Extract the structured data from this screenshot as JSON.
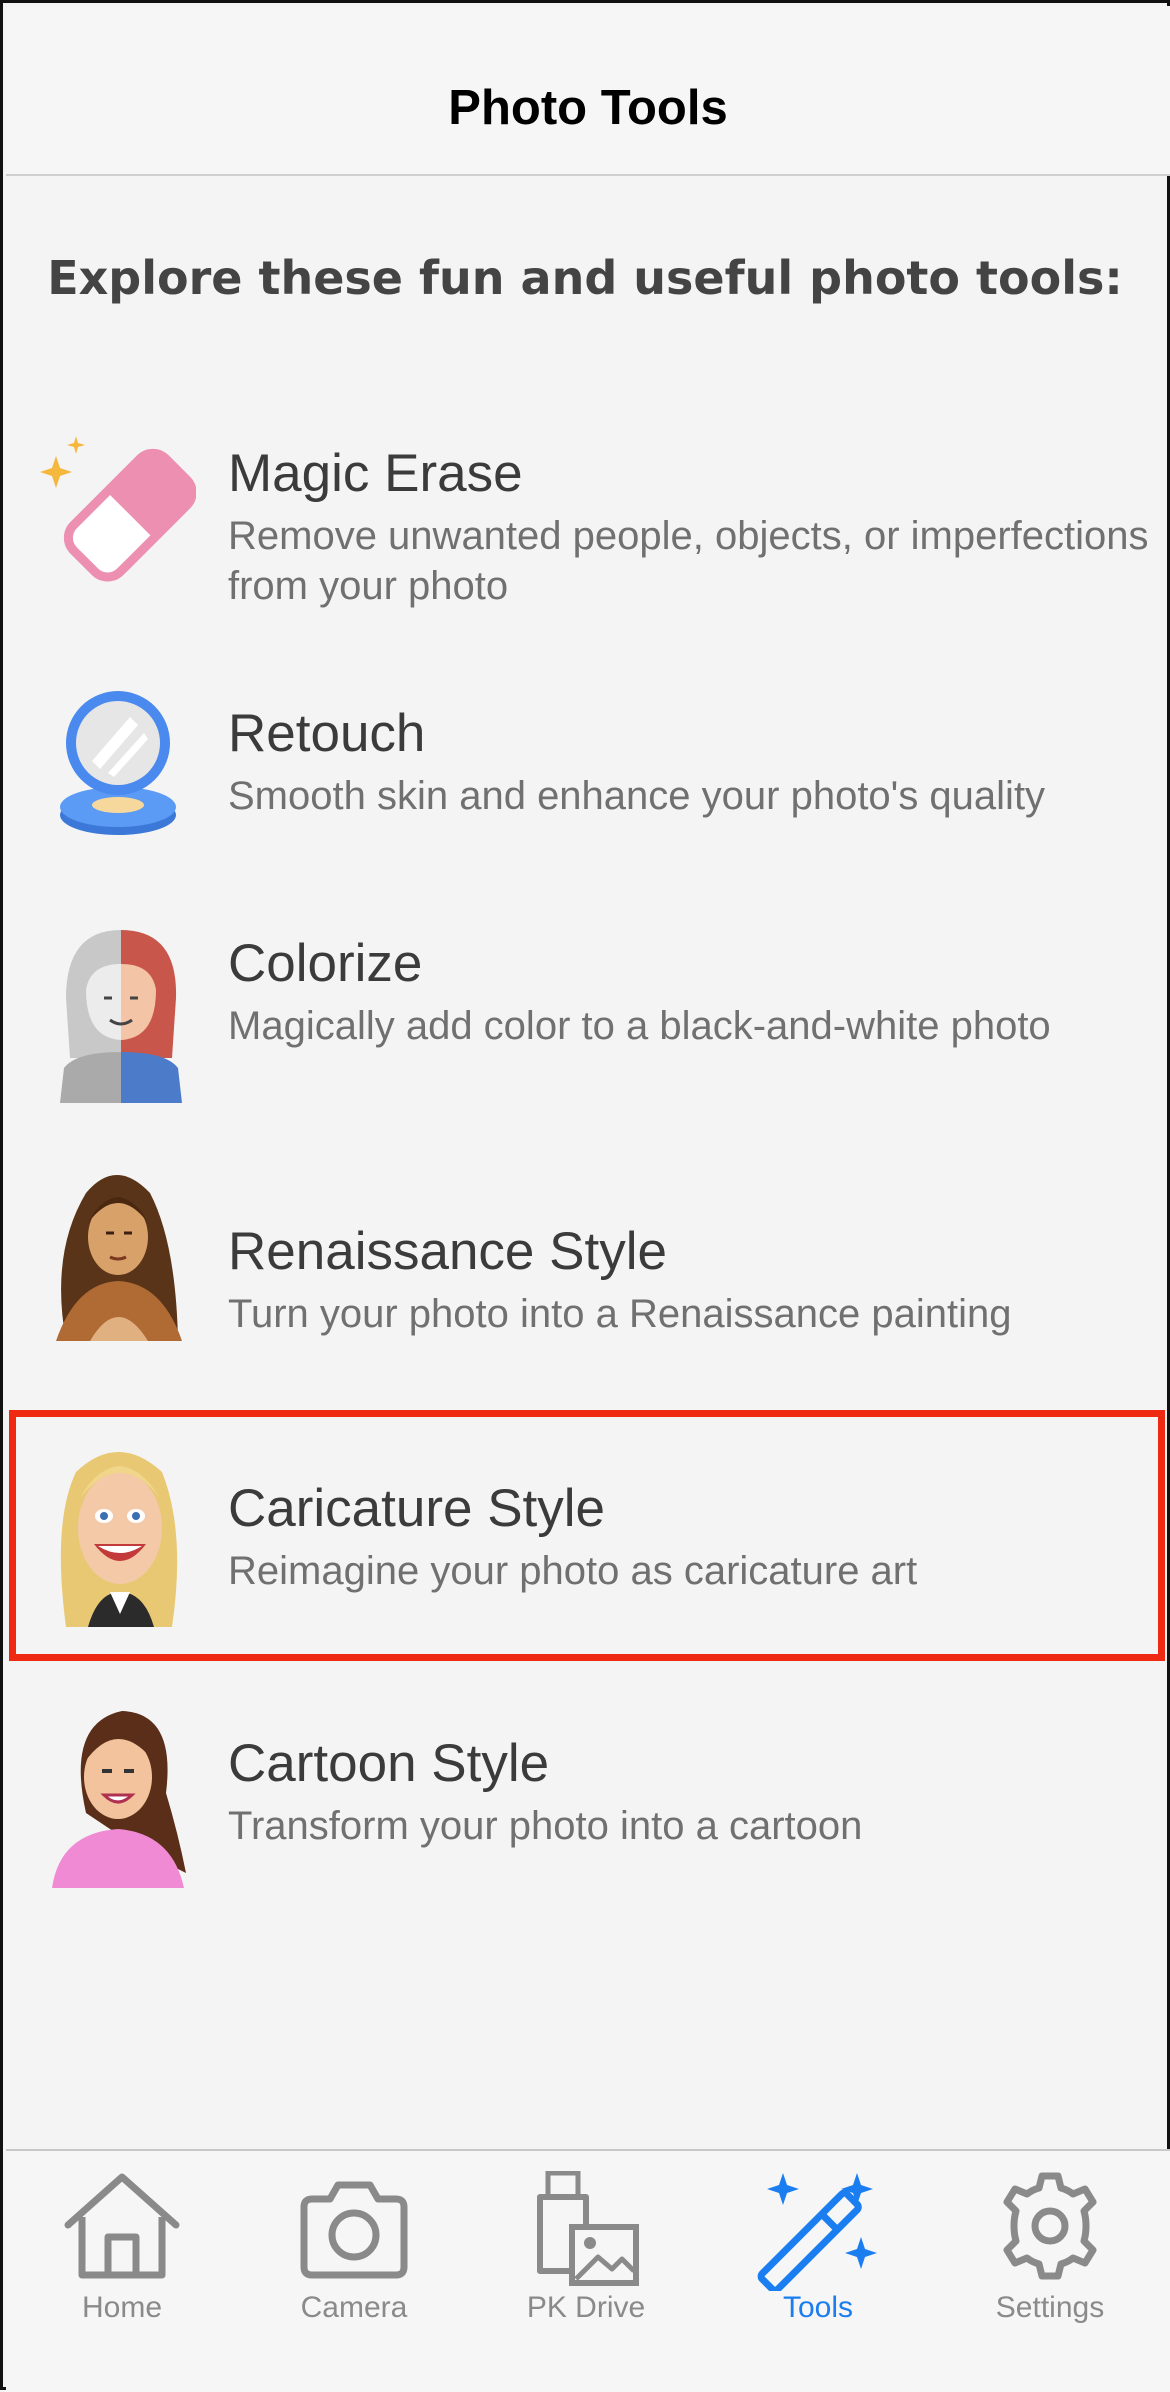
{
  "header": {
    "title": "Photo Tools"
  },
  "intro": "Explore these fun and useful photo tools:",
  "tools": [
    {
      "title": "Magic Erase",
      "description": "Remove unwanted people, objects, or imperfections from your photo",
      "icon": "eraser-icon"
    },
    {
      "title": "Retouch",
      "description": "Smooth skin and enhance your photo's quality",
      "icon": "compact-mirror-icon"
    },
    {
      "title": "Colorize",
      "description": "Magically add color to a black-and-white photo",
      "icon": "colorize-portrait-icon"
    },
    {
      "title": "Renaissance Style",
      "description": "Turn your photo into a Renaissance painting",
      "icon": "renaissance-portrait-icon"
    },
    {
      "title": "Caricature Style",
      "description": "Reimagine your photo as caricature art",
      "icon": "caricature-portrait-icon",
      "highlighted": true
    },
    {
      "title": "Cartoon Style",
      "description": "Transform your photo into a cartoon",
      "icon": "cartoon-portrait-icon"
    }
  ],
  "tabs": [
    {
      "label": "Home",
      "icon": "home-icon"
    },
    {
      "label": "Camera",
      "icon": "camera-icon"
    },
    {
      "label": "PK Drive",
      "icon": "drive-icon"
    },
    {
      "label": "Tools",
      "icon": "magic-wand-icon",
      "active": true
    },
    {
      "label": "Settings",
      "icon": "gear-icon"
    }
  ],
  "colors": {
    "accent": "#1a7df0",
    "highlight": "#ee2b12",
    "inactive_tab": "#8a8a8a"
  }
}
